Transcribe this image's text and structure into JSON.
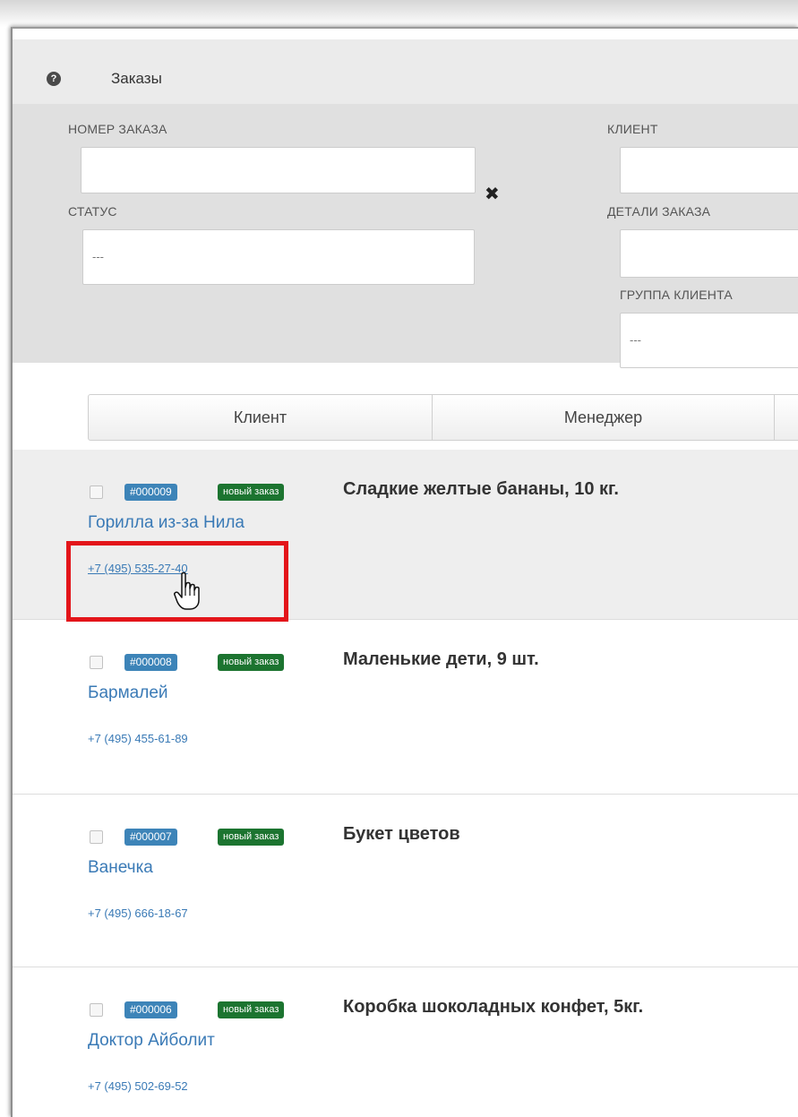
{
  "page": {
    "title": "Заказы",
    "help_icon": "?"
  },
  "filters": {
    "order_number_label": "НОМЕР ЗАКАЗА",
    "order_number_value": "",
    "clear_icon": "✖",
    "client_label": "КЛИЕНТ",
    "client_value": "",
    "status_label": "СТАТУС",
    "status_value": "---",
    "details_label": "ДЕТАЛИ ЗАКАЗА",
    "details_value": "",
    "client_group_label": "ГРУППА КЛИЕНТА",
    "client_group_value": "---"
  },
  "tabs": [
    {
      "label": "Клиент"
    },
    {
      "label": "Менеджер"
    }
  ],
  "orders": [
    {
      "number": "#000009",
      "status": "новый заказ",
      "title": "Сладкие желтые бананы, 10 кг.",
      "client": "Горилла из-за Нила",
      "phone": "+7 (495) 535-27-40"
    },
    {
      "number": "#000008",
      "status": "новый заказ",
      "title": "Маленькие дети, 9 шт.",
      "client": "Бармалей",
      "phone": "+7 (495) 455-61-89"
    },
    {
      "number": "#000007",
      "status": "новый заказ",
      "title": "Букет цветов",
      "client": "Ванечка",
      "phone": "+7 (495) 666-18-67"
    },
    {
      "number": "#000006",
      "status": "новый заказ",
      "title": "Коробка шоколадных конфет, 5кг.",
      "client": "Доктор Айболит",
      "phone": "+7 (495) 502-69-52"
    }
  ],
  "colors": {
    "number_badge": "#3d84b8",
    "status_badge": "#1c7430",
    "link": "#3a7ab6",
    "highlight": "#e3151a"
  }
}
